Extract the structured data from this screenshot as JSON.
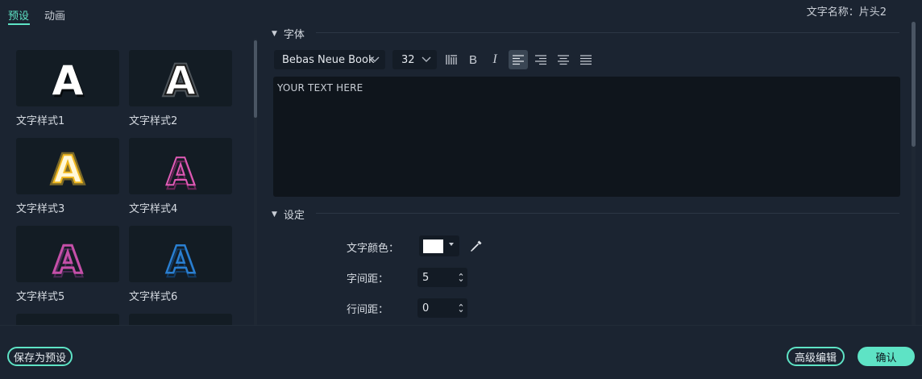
{
  "tabs": {
    "presets": "预设",
    "animation": "动画"
  },
  "text_name": "文字名称：片头2",
  "presets": [
    {
      "label": "文字样式1",
      "icon": "letter-a-white-shadow"
    },
    {
      "label": "文字样式2",
      "icon": "letter-a-white-glow"
    },
    {
      "label": "文字样式3",
      "icon": "letter-a-gold-glow"
    },
    {
      "label": "文字样式4",
      "icon": "letter-a-pink-outline"
    },
    {
      "label": "文字样式5",
      "icon": "letter-a-pink-gradient-outline"
    },
    {
      "label": "文字样式6",
      "icon": "letter-a-blue-outline"
    }
  ],
  "font_section": {
    "title": "字体",
    "font_family": "Bebas Neue Book",
    "font_size": "32",
    "text_value": "YOUR TEXT HERE"
  },
  "settings_section": {
    "title": "设定",
    "text_color_label": "文字颜色：",
    "text_color": "#ffffff",
    "letter_spacing_label": "字间距：",
    "letter_spacing": "5",
    "line_spacing_label": "行间距：",
    "line_spacing": "0"
  },
  "buttons": {
    "save_preset": "保存为预设",
    "advanced_edit": "高级编辑",
    "confirm": "确认"
  },
  "colors": {
    "accent": "#5ee3c5",
    "background": "#1b2431"
  }
}
